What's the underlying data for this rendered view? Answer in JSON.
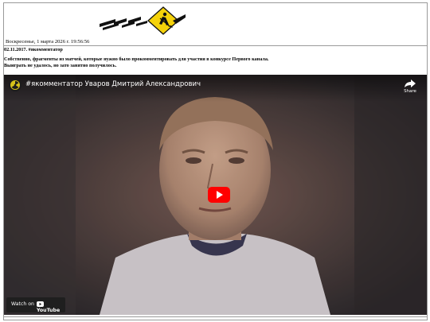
{
  "header": {
    "logo_icon": "man-digging-sign-icon",
    "accent": "#f5d20a"
  },
  "datebar": {
    "text": "Воскресенье, 1 марта 2026 г. 19:56:56"
  },
  "post": {
    "title": "02.11.2017. #якомментатор",
    "body_line1": "Собственно, фрагменты из матчей, которые нужно было прокомментировать для участия в конкурсе Первого канала.",
    "body_line2": "Выиграть не удалось, но зато занятно получилось."
  },
  "video": {
    "title": "#якомментатор Уваров Дмитрий Александрович",
    "share_label": "Share",
    "watch_on_label": "Watch on",
    "youtube_label": "YouTube",
    "play_color": "#ff0000"
  }
}
